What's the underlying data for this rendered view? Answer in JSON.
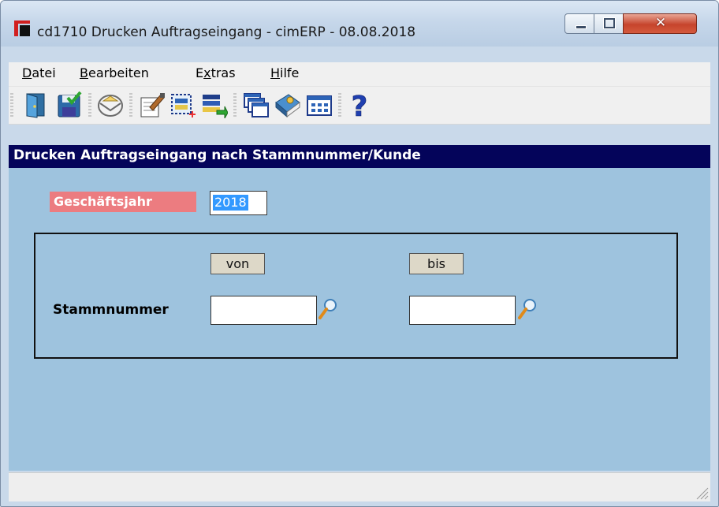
{
  "window": {
    "title": "cd1710 Drucken Auftragseingang - cimERP - 08.08.2018",
    "controls": {
      "minimize": "minimize-icon",
      "maximize": "maximize-icon",
      "close": "close-icon"
    }
  },
  "menu": {
    "items": [
      {
        "accel": "D",
        "rest": "atei"
      },
      {
        "accel": "B",
        "rest": "earbeiten"
      },
      {
        "pre": "E",
        "accel": "x",
        "rest": "tras"
      },
      {
        "accel": "H",
        "rest": "ilfe"
      }
    ]
  },
  "toolbar": {
    "icons": [
      "exit-door-icon",
      "save-icon",
      "mail-icon",
      "edit-record-icon",
      "new-record-icon",
      "list-transfer-icon",
      "windows-icon",
      "book-icon",
      "table-icon",
      "help-icon"
    ]
  },
  "header": {
    "text": "Drucken Auftragseingang nach Stammnummer/Kunde"
  },
  "form": {
    "fiscal_year": {
      "label": "Geschäftsjahr",
      "value": "2018"
    },
    "range": {
      "from_label": "von",
      "to_label": "bis",
      "stamm_label": "Stammnummer",
      "from_value": "",
      "to_value": ""
    }
  },
  "colors": {
    "header_bg": "#04045a",
    "content_bg": "#9ec3de",
    "fiscal_label_bg": "#ec7c80",
    "selection": "#3399ff"
  }
}
